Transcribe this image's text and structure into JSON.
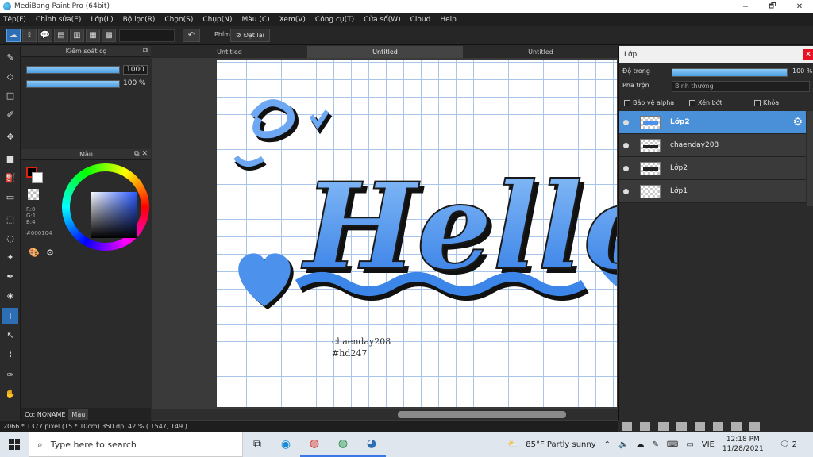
{
  "window": {
    "title": "MediBang Paint Pro (64bit)",
    "minimize": "🗕",
    "restore": "🗗",
    "close": "✕"
  },
  "menu": [
    "Tệp(F)",
    "Chỉnh sửa(E)",
    "Lớp(L)",
    "Bộ lọc(R)",
    "Chọn(S)",
    "Chụp(N)",
    "Màu (C)",
    "Xem(V)",
    "Công cụ(T)",
    "Cửa sổ(W)",
    "Cloud",
    "Help"
  ],
  "toolbar": {
    "phim_label": "Phím",
    "reset_label": "Đặt lại",
    "reset_icon": "⊘",
    "undo_icon": "↶"
  },
  "brush_panel": {
    "title": "Kiểm soát cọ",
    "size_value": "1000",
    "size_fraction": 1.0,
    "opacity_value": "100 %",
    "opacity_fraction": 1.0
  },
  "color_panel": {
    "title": "Màu",
    "r": "R:0",
    "g": "G:1",
    "b": "B:4",
    "hex": "#000104",
    "fg_color": "#000104",
    "bg_color": "#ffffff"
  },
  "bottom_tabs": [
    "Co: NONAME",
    "Màu"
  ],
  "documents": [
    "Untitled",
    "Untitled",
    "Untitled"
  ],
  "active_document": 1,
  "canvas": {
    "artwork_text": "Hello",
    "signature_line1": "chaenday208",
    "signature_line2": "#hd247",
    "ink_color": "#3b86e8",
    "shadow_color": "#111111"
  },
  "layer_panel": {
    "title": "Lớp",
    "opacity_label": "Độ trong",
    "opacity_value": "100 %",
    "opacity_fraction": 1.0,
    "blend_label": "Pha trộn",
    "blend_value": "Bình thường",
    "protect_alpha": "Bảo vệ alpha",
    "clipping": "Xén bớt",
    "lock": "Khóa",
    "layers": [
      {
        "name": "Lớp2",
        "selected": true
      },
      {
        "name": "chaenday208",
        "selected": false
      },
      {
        "name": "Lớp2",
        "selected": false
      },
      {
        "name": "Lớp1",
        "selected": false
      }
    ]
  },
  "status": {
    "text": "2066 * 1377 pixel   (15 * 10cm)   350 dpi   42 %   ( 1547, 149 )"
  },
  "taskbar": {
    "search_placeholder": "Type here to search",
    "weather": "85°F  Partly sunny",
    "lang": "VIE",
    "time": "12:18 PM",
    "date": "11/28/2021",
    "notifications": "2"
  }
}
